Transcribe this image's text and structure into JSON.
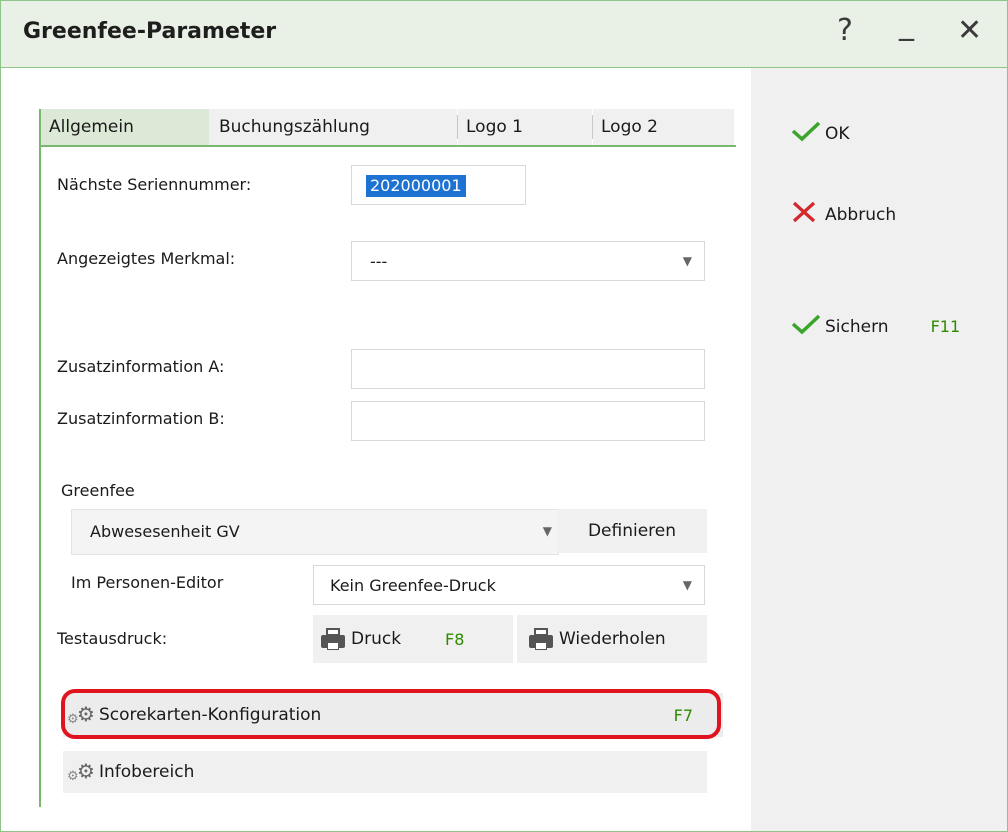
{
  "window": {
    "title": "Greenfee-Parameter",
    "help": "?",
    "minimize": "_",
    "close": "✕"
  },
  "actions": {
    "ok": "OK",
    "abbruch": "Abbruch",
    "sichern": "Sichern",
    "sichern_key": "F11"
  },
  "tabs": [
    "Allgemein",
    "Buchungszählung",
    "Logo 1",
    "Logo 2"
  ],
  "fields": {
    "serial_label": "Nächste Seriennummer:",
    "serial_value": "202000001",
    "merkmal_label": "Angezeigtes Merkmal:",
    "merkmal_value": "---",
    "zusatz_a_label": "Zusatzinformation A:",
    "zusatz_a_value": "",
    "zusatz_b_label": "Zusatzinformation B:",
    "zusatz_b_value": ""
  },
  "greenfee": {
    "section_label": "Greenfee",
    "selected": "Abwesesenheit GV",
    "define_button": "Definieren",
    "editor_label": "Im Personen-Editor",
    "editor_value": "Kein Greenfee-Druck"
  },
  "testdruck": {
    "label": "Testausdruck:",
    "druck": "Druck",
    "druck_key": "F8",
    "wiederholen": "Wiederholen"
  },
  "bottom_buttons": {
    "scorekarten": "Scorekarten-Konfiguration",
    "scorekarten_key": "F7",
    "infobereich": "Infobereich"
  },
  "colors": {
    "accent_green": "#79b86e",
    "key_green": "#2e8b00",
    "highlight_red": "#e0141e",
    "selection_blue": "#1e73d2"
  }
}
